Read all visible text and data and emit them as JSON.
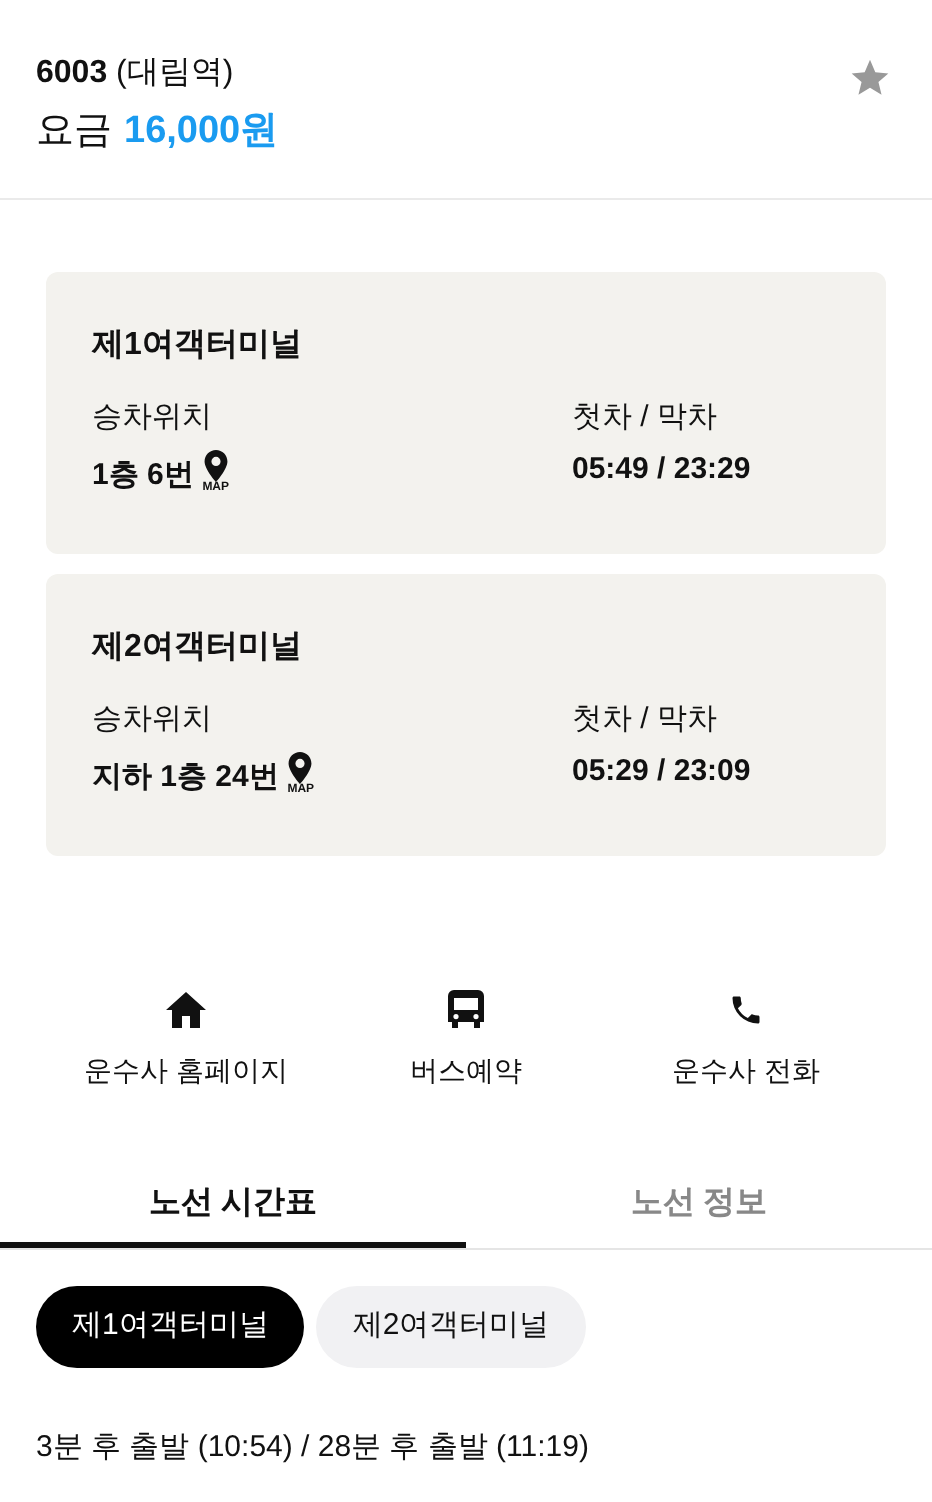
{
  "header": {
    "title": "**6003** (대림역)",
    "fare_label": "요금",
    "fare_amount": "16,000원",
    "favorite": false
  },
  "stops": [
    {
      "name": "제1여객터미널",
      "boarding_label": "승차위치",
      "boarding": "1층 6번",
      "map_label": "MAP",
      "time_label": "첫차 / 막차",
      "times": "05:49 / 23:29"
    },
    {
      "name": "제2여객터미널",
      "boarding_label": "승차위치",
      "boarding": "지하 1층 24번",
      "map_label": "MAP",
      "time_label": "첫차 / 막차",
      "times": "05:29 / 23:09"
    }
  ],
  "actions": [
    {
      "kind": "home",
      "label": "운수사 홈페이지"
    },
    {
      "kind": "bus",
      "label": "버스예약"
    },
    {
      "kind": "phone",
      "label": "운수사 전화"
    }
  ],
  "tabs": [
    {
      "label": "노선 시간표",
      "selected": true
    },
    {
      "label": "노선 정보",
      "selected": false
    }
  ],
  "chips": [
    {
      "label": "제1여객터미널",
      "selected": true
    },
    {
      "label": "제2여객터미널",
      "selected": false
    }
  ],
  "departure": "3분 후 출발 (10:54) / 28분 후 출발 (11:19)"
}
